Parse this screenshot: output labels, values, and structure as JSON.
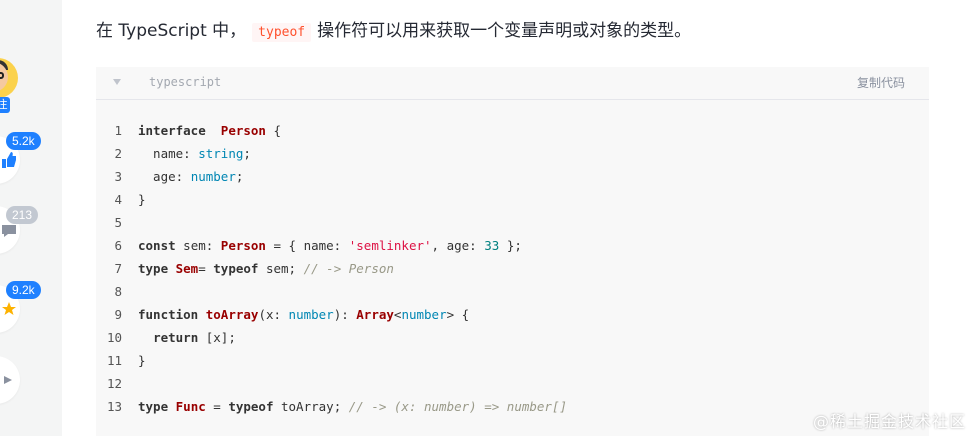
{
  "sidebar": {
    "follow_label": "注",
    "like_count": "5.2k",
    "comment_count": "213",
    "collect_count": "9.2k"
  },
  "article": {
    "para_before": "在 TypeScript 中，",
    "inline_code": "typeof",
    "para_after": "操作符可以用来获取一个变量声明或对象的类型。"
  },
  "code": {
    "language": "typescript",
    "copy_label": "复制代码",
    "lines": [
      {
        "n": "1",
        "tokens": [
          [
            "kw",
            "interface"
          ],
          [
            "",
            "  "
          ],
          [
            "ty",
            "Person"
          ],
          [
            "",
            " {"
          ]
        ]
      },
      {
        "n": "2",
        "tokens": [
          [
            "",
            "  name: "
          ],
          [
            "bt",
            "string"
          ],
          [
            "",
            ";"
          ]
        ]
      },
      {
        "n": "3",
        "tokens": [
          [
            "",
            "  age: "
          ],
          [
            "bt",
            "number"
          ],
          [
            "",
            ";"
          ]
        ]
      },
      {
        "n": "4",
        "tokens": [
          [
            "",
            "}"
          ]
        ]
      },
      {
        "n": "5",
        "tokens": []
      },
      {
        "n": "6",
        "tokens": [
          [
            "kw",
            "const"
          ],
          [
            "",
            " sem: "
          ],
          [
            "ty",
            "Person"
          ],
          [
            "",
            " = { name: "
          ],
          [
            "st",
            "'semlinker'"
          ],
          [
            "",
            ", age: "
          ],
          [
            "nm",
            "33"
          ],
          [
            "",
            " };"
          ]
        ]
      },
      {
        "n": "7",
        "tokens": [
          [
            "kw",
            "type"
          ],
          [
            "",
            ""
          ],
          [
            "ty",
            " Sem"
          ],
          [
            "",
            "= "
          ],
          [
            "kw",
            "typeof"
          ],
          [
            "",
            " sem; "
          ],
          [
            "cm",
            "// -> Person"
          ]
        ]
      },
      {
        "n": "8",
        "tokens": []
      },
      {
        "n": "9",
        "tokens": [
          [
            "kw",
            "function"
          ],
          [
            "",
            " "
          ],
          [
            "ty",
            "toArray"
          ],
          [
            "",
            "(x: "
          ],
          [
            "bt",
            "number"
          ],
          [
            "",
            "): "
          ],
          [
            "ty",
            "Array"
          ],
          [
            "",
            "<"
          ],
          [
            "bt",
            "number"
          ],
          [
            "",
            "> {"
          ]
        ]
      },
      {
        "n": "10",
        "tokens": [
          [
            "",
            "  "
          ],
          [
            "kw",
            "return"
          ],
          [
            "",
            " [x];"
          ]
        ]
      },
      {
        "n": "11",
        "tokens": [
          [
            "",
            "}"
          ]
        ]
      },
      {
        "n": "12",
        "tokens": []
      },
      {
        "n": "13",
        "tokens": [
          [
            "kw",
            "type"
          ],
          [
            "",
            " "
          ],
          [
            "ty",
            "Func"
          ],
          [
            "",
            " = "
          ],
          [
            "kw",
            "typeof"
          ],
          [
            "",
            " toArray; "
          ],
          [
            "cm",
            "// -> (x: number) => number[]"
          ]
        ]
      }
    ]
  },
  "watermark": "@稀土掘金技术社区"
}
